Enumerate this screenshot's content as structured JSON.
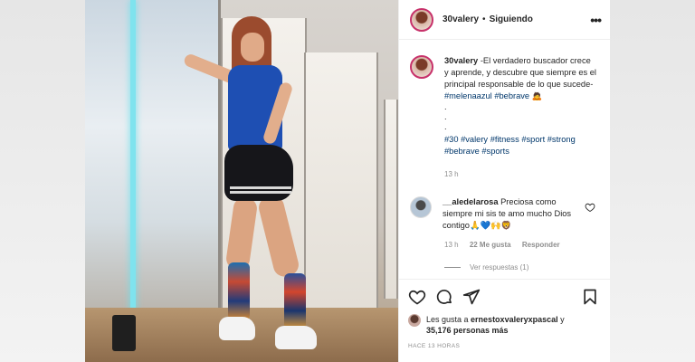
{
  "post": {
    "username": "30valery",
    "follow_status": "Siguiendo",
    "caption": {
      "username": "30valery",
      "text": " -El verdadero buscador crece y aprende, y descubre que siempre es el principal responsable de lo que sucede- ",
      "tags_inline": [
        "#melenaazul",
        "#bebrave"
      ],
      "emoji": "🙇",
      "dots": [
        ".",
        ".",
        "."
      ],
      "hashtags": [
        "#30",
        "#valery",
        "#fitness",
        "#sport",
        "#strong",
        "#bebrave",
        "#sports"
      ],
      "time": "13 h"
    },
    "comment": {
      "username": "__aledelarosa",
      "text": " Preciosa como siempre mi sis te amo mucho Dios contigo🙏💙🙌🦁",
      "time": "13 h",
      "likes": "22 Me gusta",
      "reply": "Responder",
      "view_replies": "Ver respuestas (1)"
    },
    "likes": {
      "prefix": "Les gusta a ",
      "user": "ernestoxvaleryxpascal",
      "middle": " y",
      "count": "35,176 personas más"
    },
    "posted_ago": "HACE 13 HORAS"
  },
  "icons": [
    "heart-icon",
    "comment-icon",
    "share-icon",
    "bookmark-icon",
    "more-icon"
  ],
  "colors": {
    "hashtag": "#00376b",
    "ring": "#c7316a",
    "muted": "#8e8e8e"
  }
}
